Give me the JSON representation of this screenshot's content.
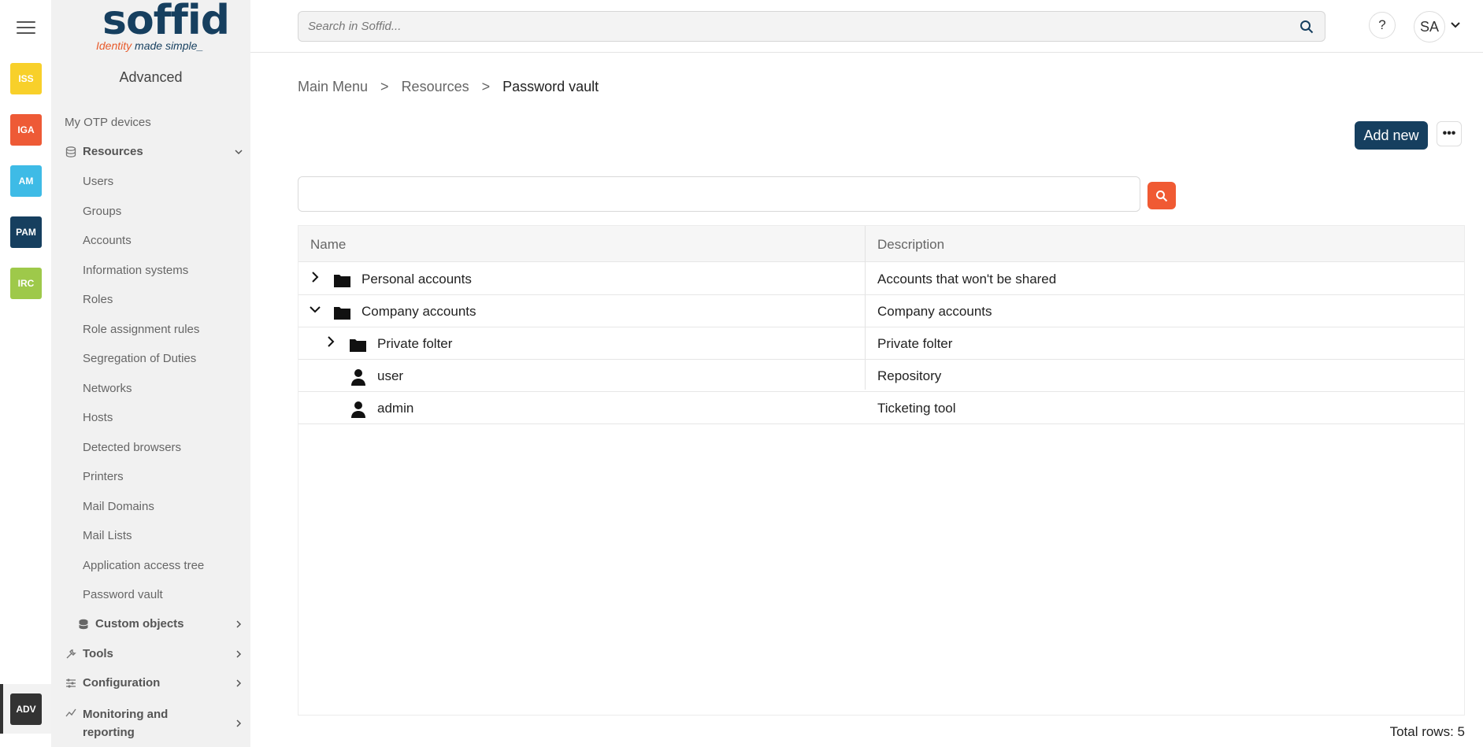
{
  "rail": {
    "tiles": [
      {
        "label": "ISS",
        "color": "#f8d02a"
      },
      {
        "label": "IGA",
        "color": "#ee5a36"
      },
      {
        "label": "AM",
        "color": "#3ebbe6"
      },
      {
        "label": "PAM",
        "color": "#163f5f"
      },
      {
        "label": "IRC",
        "color": "#9ec94a"
      }
    ],
    "active_tile": {
      "label": "ADV",
      "color": "#333333"
    }
  },
  "logo": {
    "word": "soffid",
    "tag_a": "Identity",
    "tag_b": "made simple_"
  },
  "sidebar": {
    "title": "Advanced",
    "otp": "My OTP devices",
    "resources": "Resources",
    "items": [
      "Users",
      "Groups",
      "Accounts",
      "Information systems",
      "Roles",
      "Role assignment rules",
      "Segregation of Duties",
      "Networks",
      "Hosts",
      "Detected browsers",
      "Printers",
      "Mail Domains",
      "Mail Lists",
      "Application access tree",
      "Password vault"
    ],
    "custom_objects": "Custom objects",
    "tools": "Tools",
    "configuration": "Configuration",
    "monitoring": "Monitoring and reporting"
  },
  "topbar": {
    "search_placeholder": "Search in Soffid...",
    "help": "?",
    "avatar": "SA"
  },
  "breadcrumb": {
    "root": "Main Menu",
    "sep1": ">",
    "section": "Resources",
    "sep2": ">",
    "current": "Password vault"
  },
  "actions": {
    "add_new": "Add new",
    "more": "•••"
  },
  "table": {
    "headers": {
      "name": "Name",
      "description": "Description"
    },
    "rows": [
      {
        "name": "Personal accounts",
        "description": "Accounts that won't be shared"
      },
      {
        "name": "Company accounts",
        "description": "Company accounts"
      },
      {
        "name": "Private folter",
        "description": "Private folter"
      },
      {
        "name": "user",
        "description": "Repository"
      },
      {
        "name": "admin",
        "description": "Ticketing tool"
      }
    ],
    "total": "Total rows: 5"
  },
  "colors": {
    "accent": "#163f5f",
    "search_button": "#f05a33"
  },
  "icons": [
    "hamburger-icon",
    "search-icon",
    "chevron-down-icon",
    "chevron-right-icon",
    "folder-icon",
    "user-icon",
    "database-icon",
    "wrench-icon",
    "sliders-icon",
    "chart-line-icon"
  ]
}
